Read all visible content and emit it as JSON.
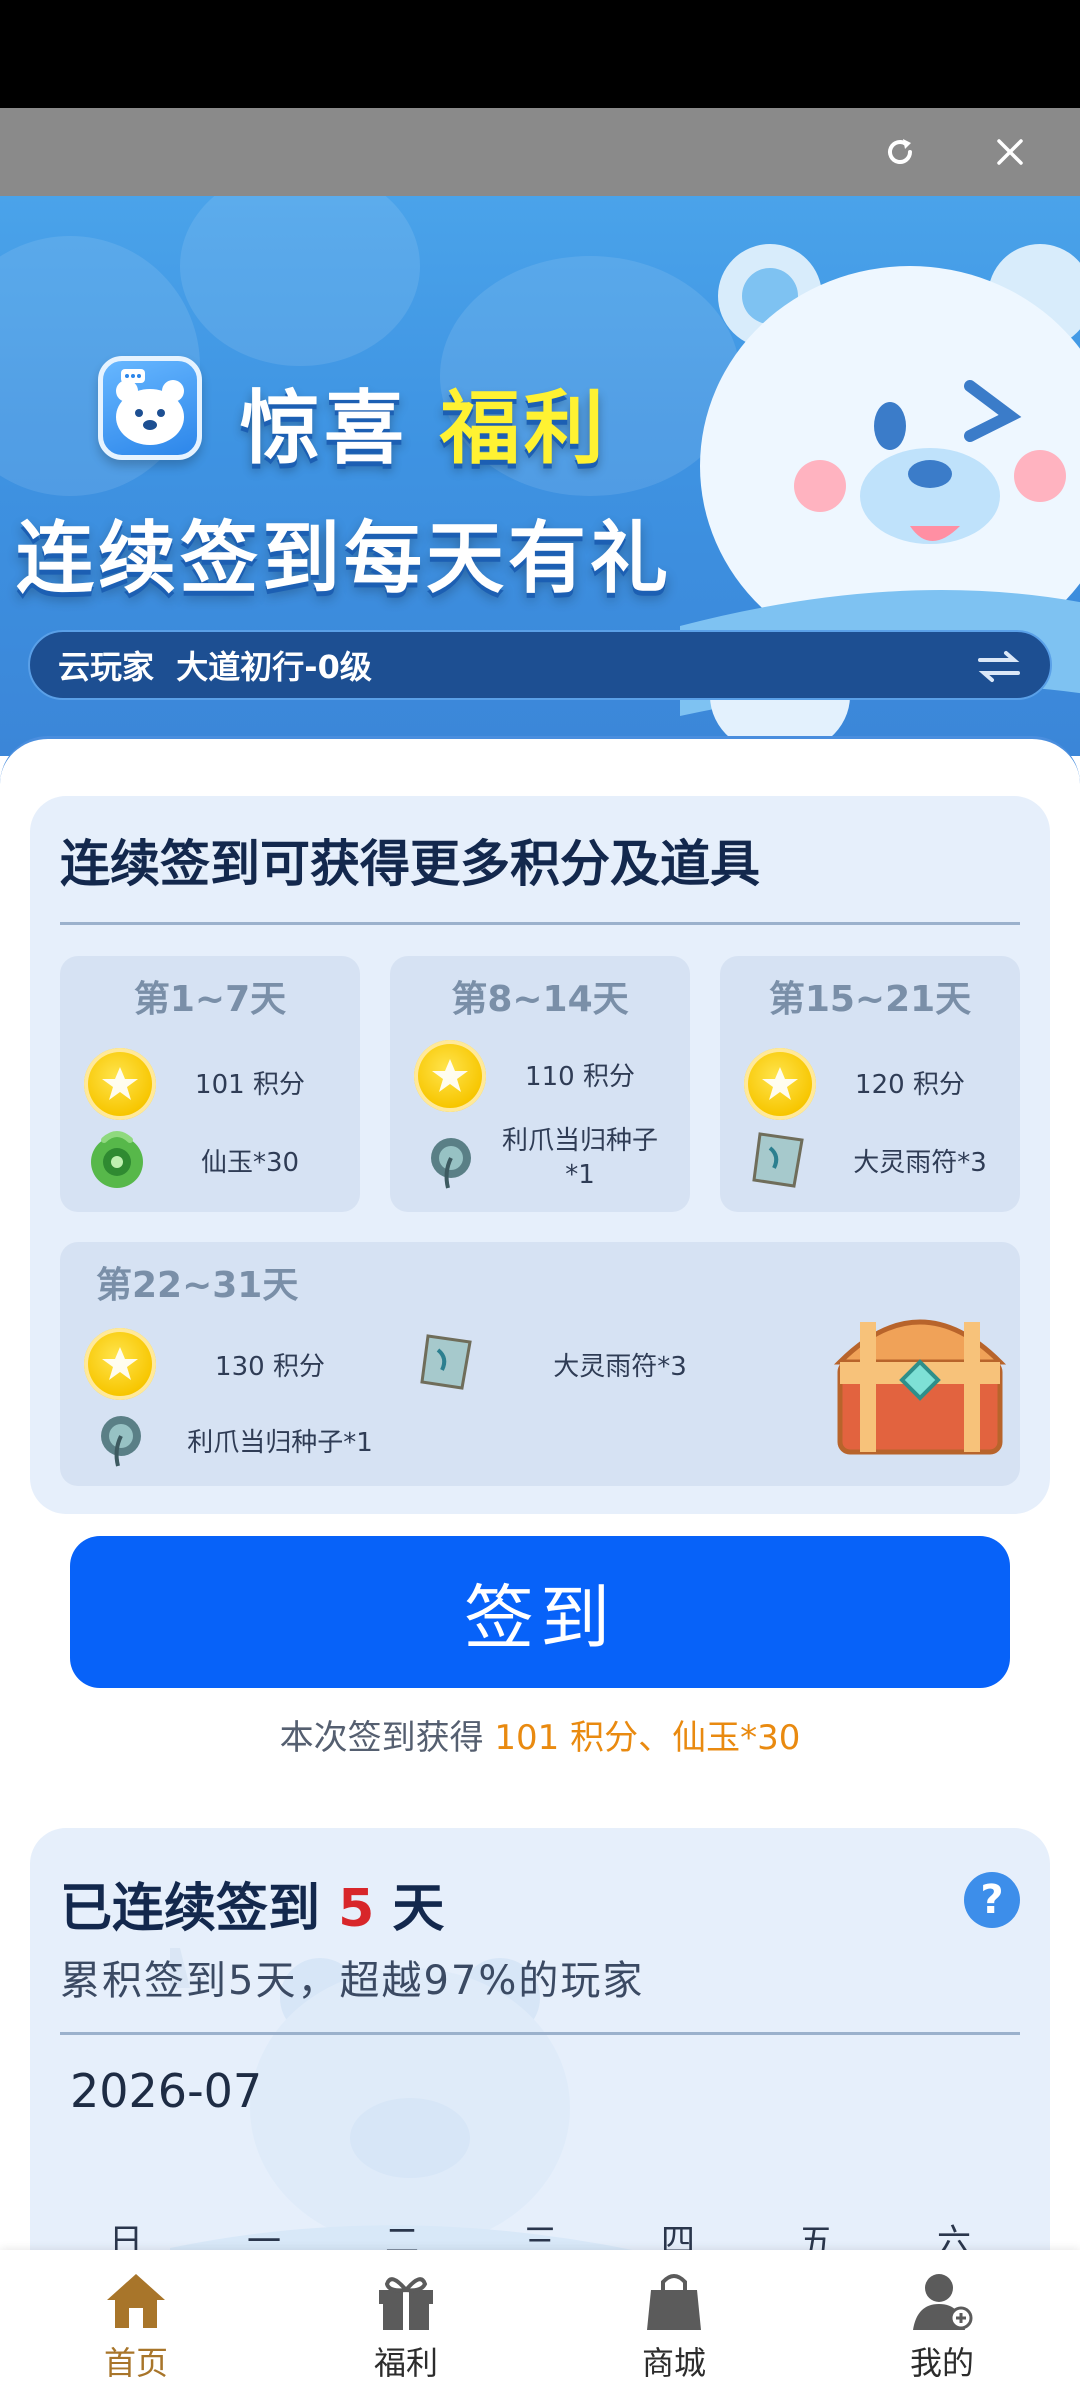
{
  "hero": {
    "title_part1": "惊喜",
    "title_part2": "福利",
    "subtitle": "连续签到每天有礼",
    "level_text": "云玩家  大道初行-0级"
  },
  "rewards": {
    "title": "连续签到可获得更多积分及道具",
    "tiers": [
      {
        "title": "第1~7天",
        "points": "101 积分",
        "item": "仙玉*30"
      },
      {
        "title": "第8~14天",
        "points": "110 积分",
        "item_line1": "利爪当归种子",
        "item_line2": "*1"
      },
      {
        "title": "第15~21天",
        "points": "120 积分",
        "item": "大灵雨符*3"
      },
      {
        "title": "第22~31天",
        "points": "130 积分",
        "item_a": "大灵雨符*3",
        "item_b": "利爪当归种子*1"
      }
    ]
  },
  "signin": {
    "button_label": "签到",
    "note_prefix": "本次签到获得 ",
    "note_highlight": "101 积分、仙玉*30"
  },
  "streak": {
    "title_prefix": "已连续签到 ",
    "days": "5",
    "title_suffix": " 天",
    "subtitle": "累积签到5天，超越97%的玩家",
    "month": "2026-07",
    "weekdays": [
      "日",
      "一",
      "二",
      "三",
      "四",
      "五",
      "六"
    ]
  },
  "nav": {
    "items": [
      {
        "label": "首页"
      },
      {
        "label": "福利"
      },
      {
        "label": "商城"
      },
      {
        "label": "我的"
      }
    ]
  },
  "colors": {
    "primary_button": "#0762f9",
    "highlight": "#e98a10",
    "streak_number": "#d8262a",
    "nav_active": "#a8752a"
  }
}
